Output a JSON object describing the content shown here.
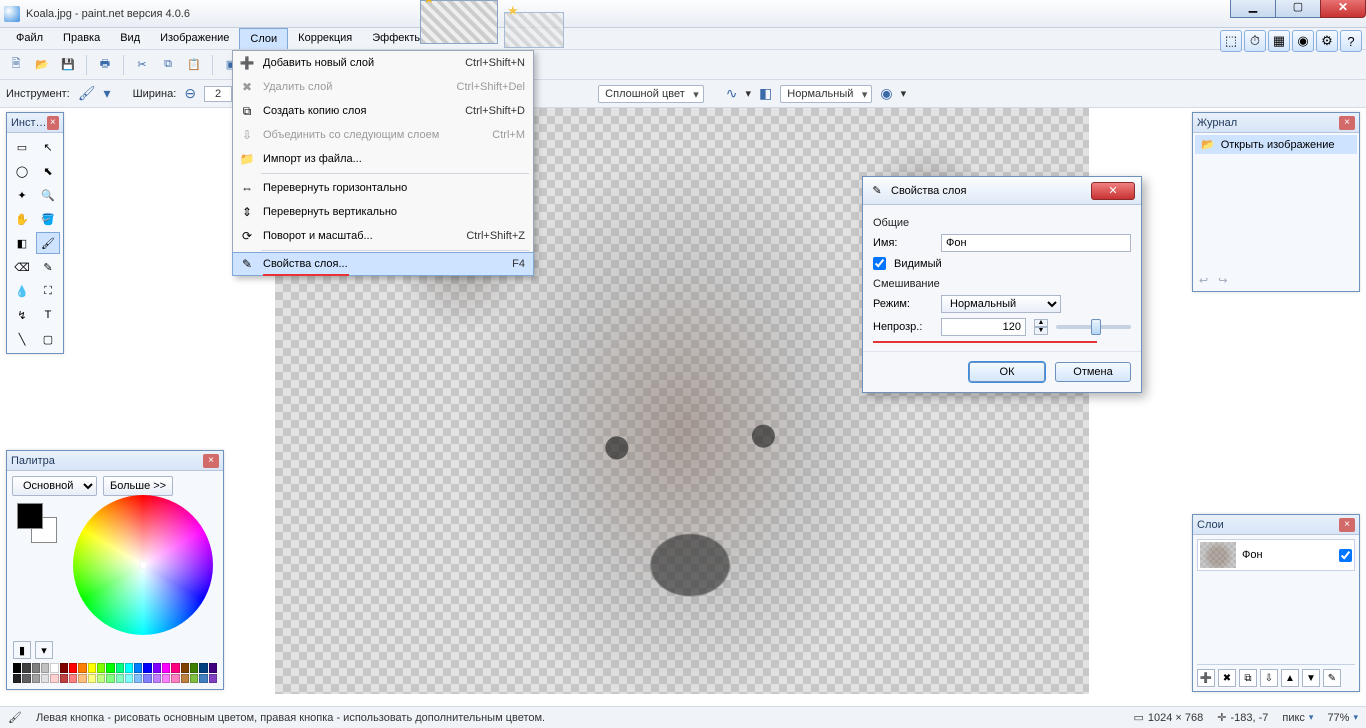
{
  "titlebar": {
    "title": "Koala.jpg - paint.net версия 4.0.6"
  },
  "menu": {
    "items": [
      "Файл",
      "Правка",
      "Вид",
      "Изображение",
      "Слои",
      "Коррекция",
      "Эффекты"
    ],
    "open_index": 4
  },
  "dropdown": {
    "items": [
      {
        "icon": "➕",
        "label": "Добавить новый слой",
        "shortcut": "Ctrl+Shift+N",
        "disabled": false
      },
      {
        "icon": "✖",
        "label": "Удалить слой",
        "shortcut": "Ctrl+Shift+Del",
        "disabled": true
      },
      {
        "icon": "⧉",
        "label": "Создать копию слоя",
        "shortcut": "Ctrl+Shift+D",
        "disabled": false
      },
      {
        "icon": "⇩",
        "label": "Объединить со следующим слоем",
        "shortcut": "Ctrl+M",
        "disabled": true
      },
      {
        "icon": "📁",
        "label": "Импорт из файла...",
        "shortcut": "",
        "disabled": false
      },
      {
        "sep": true
      },
      {
        "icon": "⇔",
        "label": "Перевернуть горизонтально",
        "shortcut": "",
        "disabled": false
      },
      {
        "icon": "⇕",
        "label": "Перевернуть вертикально",
        "shortcut": "",
        "disabled": false
      },
      {
        "icon": "⟳",
        "label": "Поворот и масштаб...",
        "shortcut": "Ctrl+Shift+Z",
        "disabled": false
      },
      {
        "sep": true
      },
      {
        "icon": "✎",
        "label": "Свойства слоя...",
        "shortcut": "F4",
        "disabled": false,
        "highlight": true
      }
    ]
  },
  "toolbar2": {
    "tool_label": "Инструмент:",
    "width_label": "Ширина:",
    "width_value": "2",
    "fill_label": "Сплошной цвет",
    "blend_label": "Нормальный"
  },
  "tools_panel": {
    "title": "Инст…"
  },
  "palette": {
    "title": "Палитра",
    "primary_select": "Основной",
    "more_btn": "Больше >>"
  },
  "history": {
    "title": "Журнал",
    "item": "Открыть изображение"
  },
  "layers": {
    "title": "Слои",
    "layer_name": "Фон"
  },
  "dialog": {
    "title": "Свойства слоя",
    "group_general": "Общие",
    "name_label": "Имя:",
    "name_value": "Фон",
    "visible_label": "Видимый",
    "group_blend": "Смешивание",
    "mode_label": "Режим:",
    "mode_value": "Нормальный",
    "opacity_label": "Непрозр.:",
    "opacity_value": "120",
    "ok": "ОК",
    "cancel": "Отмена"
  },
  "statusbar": {
    "hint": "Левая кнопка - рисовать основным цветом, правая кнопка - использовать дополнительным цветом.",
    "dims": "1024 × 768",
    "coords": "-183, -7",
    "unit": "пикс",
    "zoom": "77%"
  },
  "aux_icons": [
    "⬚",
    "⏱",
    "▦",
    "◉",
    "⚙",
    "?"
  ]
}
